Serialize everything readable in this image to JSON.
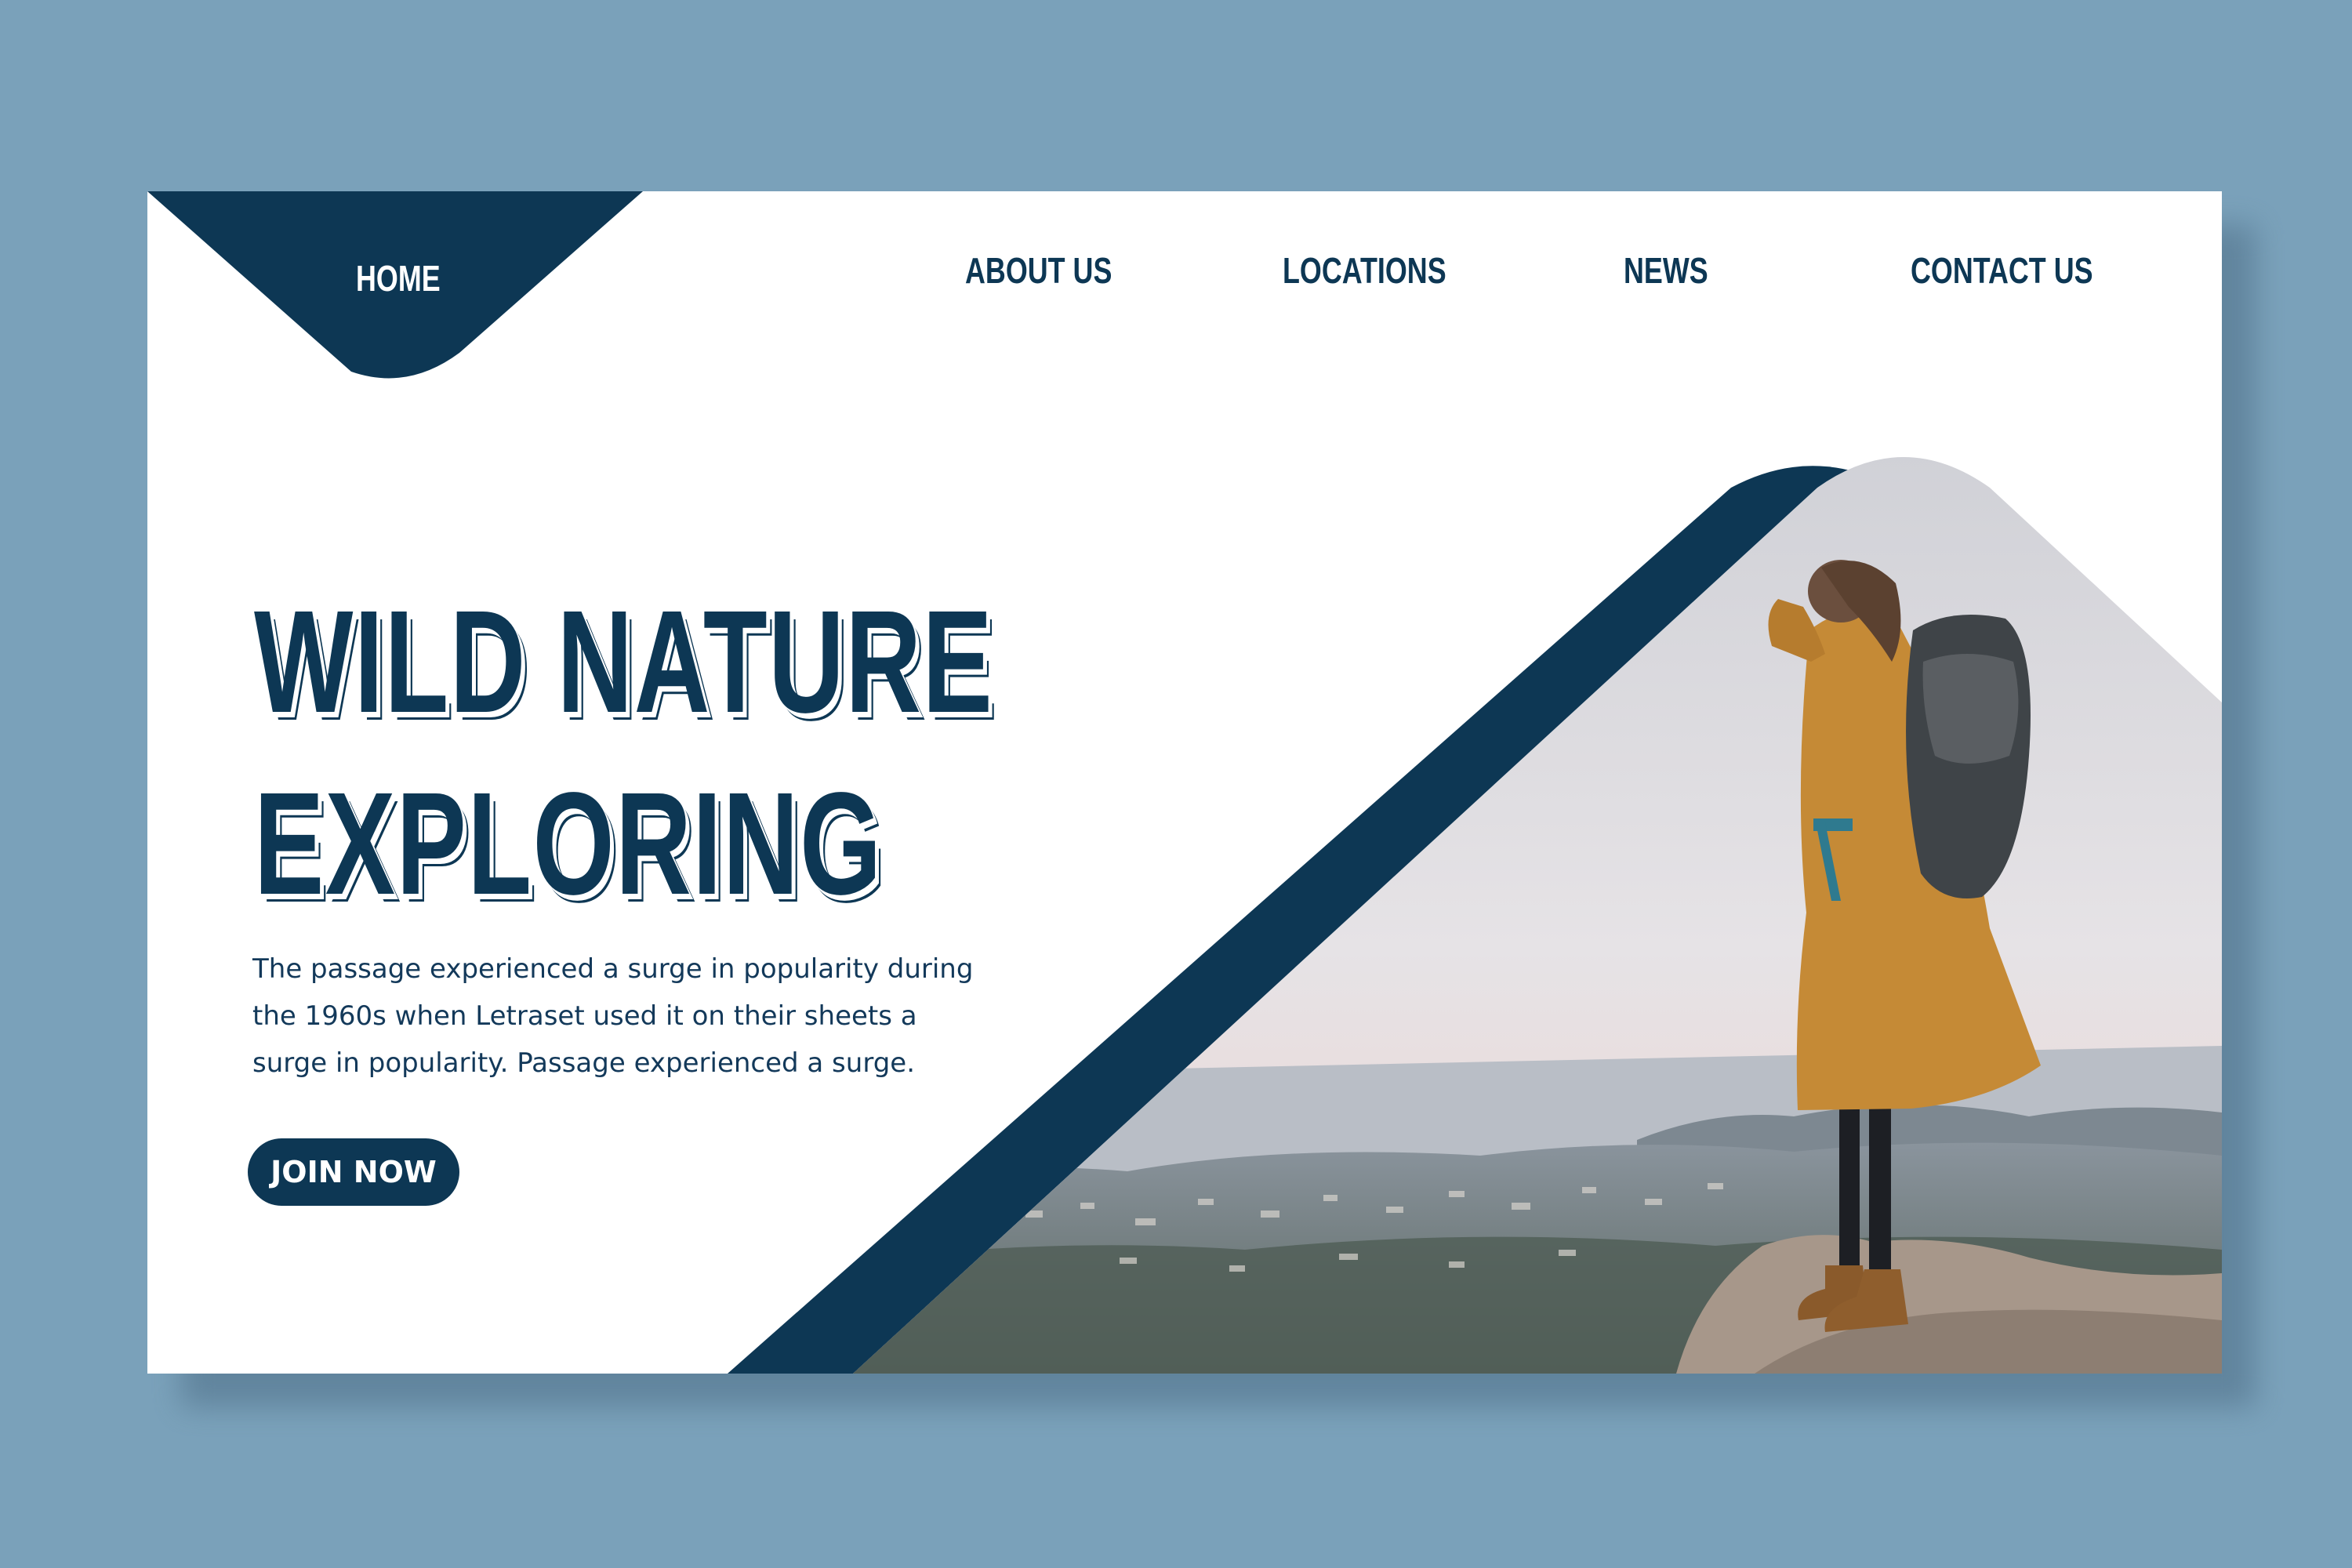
{
  "colors": {
    "background": "#7aa1ba",
    "card": "#ffffff",
    "accent": "#0d3754",
    "photo_sky": "#d9d9de"
  },
  "nav": {
    "home": "HOME",
    "about": "ABOUT US",
    "locations": "LOCATIONS",
    "news": "NEWS",
    "contact": "CONTACT US",
    "active_item": "home"
  },
  "hero": {
    "title_line1": "WILD NATURE",
    "title_line2": "EXPLORING",
    "description": "The passage experienced a surge in popularity during the 1960s when Letraset used it on their sheets a surge in popularity. Passage experienced a surge.",
    "cta_label": "JOIN NOW"
  },
  "photo": {
    "subject": "hiker-with-backpack-on-mountain-overlooking-city"
  }
}
